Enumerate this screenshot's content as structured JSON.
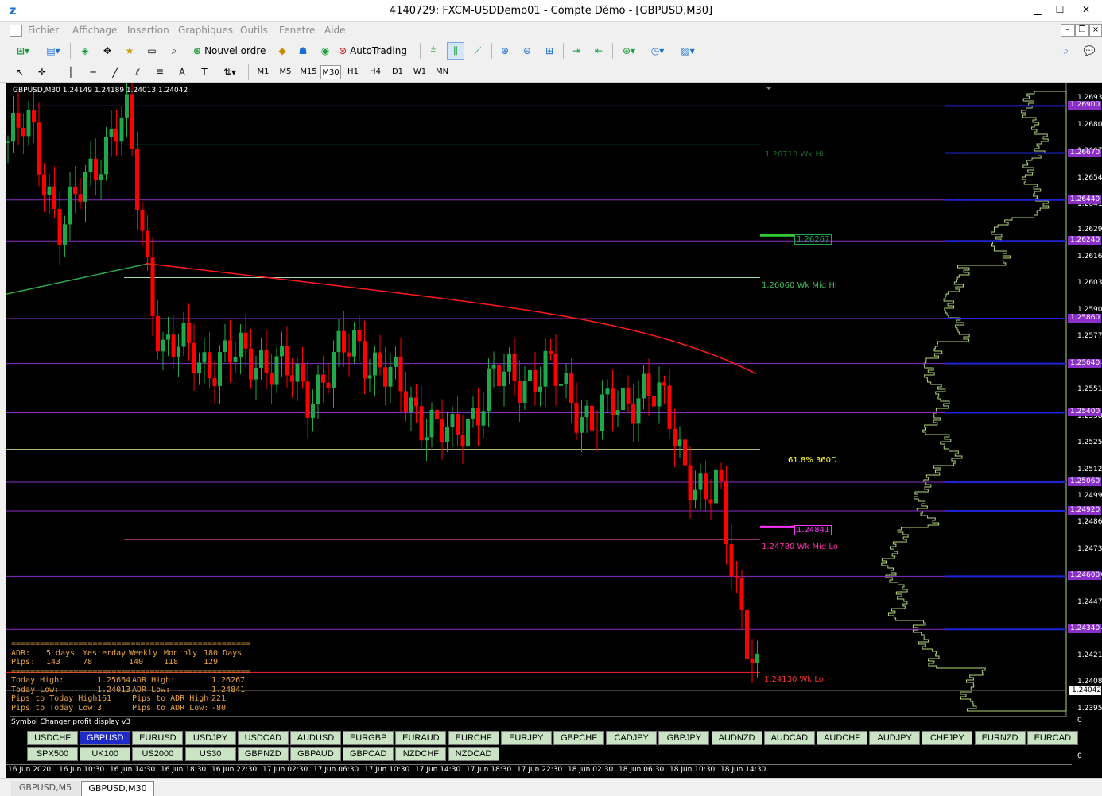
{
  "window": {
    "title": "4140729: FXCM-USDDemo01 - Compte Démo - [GBPUSD,M30]",
    "min": "▁",
    "max": "☐",
    "close": "✕"
  },
  "menu": [
    "Fichier",
    "Affichage",
    "Insertion",
    "Graphiques",
    "Outils",
    "Fenetre",
    "Aide"
  ],
  "mdi": {
    "min": "–",
    "restore": "❐",
    "close": "×"
  },
  "toolbar": {
    "new_order": "Nouvel ordre",
    "autotrading": "AutoTrading"
  },
  "timeframes": [
    "M1",
    "M5",
    "M15",
    "M30",
    "H1",
    "H4",
    "D1",
    "W1",
    "MN"
  ],
  "active_timeframe": "M30",
  "chart": {
    "label": "GBPUSD,M30  1.24149 1.24189 1.24013 1.24042",
    "price_axis": [
      "1.26935",
      "1.26805",
      "1.26675",
      "1.26545",
      "1.26415",
      "1.26290",
      "1.26160",
      "1.26030",
      "1.25900",
      "1.25770",
      "1.25640",
      "1.25510",
      "1.25380",
      "1.25250",
      "1.25120",
      "1.24990",
      "1.24860",
      "1.24730",
      "1.24600",
      "1.24470",
      "1.24340",
      "1.24210",
      "1.24080",
      "1.23950"
    ],
    "h_levels": [
      "1.26900",
      "1.26670",
      "1.26440",
      "1.26240",
      "1.25860",
      "1.25640",
      "1.25400",
      "1.25060",
      "1.24920",
      "1.24600",
      "1.24340"
    ],
    "current_price": "1.24042",
    "annotations": {
      "wk_hi": "1.26710  Wk Hi",
      "adr_high": "1.26267",
      "wk_mid_hi": "1.26060  Wk Mid Hi",
      "fib": "61.8% 360D",
      "adr_low": "1.24841",
      "wk_mid_lo": "1.24780  Wk Mid Lo",
      "wk_lo": "1.24130  Wk Lo"
    },
    "colors": {
      "bull": "#1fa84a",
      "bear": "#ff0000",
      "level": "#8b2fc9",
      "ma": "#ff1a1a",
      "vol": "#b3d77a"
    }
  },
  "chart_data": {
    "type": "candlestick",
    "symbol": "GBPUSD",
    "timeframe": "M30",
    "ohlc_last": {
      "open": 1.24149,
      "high": 1.24189,
      "low": 1.24013,
      "close": 1.24042
    },
    "ylim": [
      1.2391,
      1.2701
    ]
  },
  "stats": {
    "sep": "==================================================",
    "adr_label": "ADR:",
    "h5": "5 days",
    "hy": "Yesterday",
    "hw": "Weekly",
    "hm": "Monthly",
    "h180": "180 Days",
    "pips_label": "Pips:",
    "p5": "143",
    "py": "78",
    "pw": "140",
    "pm": "118",
    "p180": "129",
    "today_high_label": "Today High:",
    "today_high": "1.25664",
    "adr_high_label": "ADR High:",
    "adr_high": "1.26267",
    "today_low_label": "Today Low:",
    "today_low": "1.24013",
    "adr_low_label": "ADR Low:",
    "adr_low": "1.24841",
    "ptth_label": "Pips to Today High:",
    "ptth": "161",
    "ptah_label": "Pips to ADR High:",
    "ptah": "221",
    "pttl_label": "Pips to Today Low:",
    "pttl": "3",
    "ptal_label": "Pips to ADR Low:",
    "ptal": "-80"
  },
  "symbol_panel": {
    "caption": "Symbol Changer profit display v3",
    "row1": [
      "USDCHF",
      "GBPUSD",
      "EURUSD",
      "USDJPY",
      "USDCAD",
      "AUDUSD",
      "EURGBP",
      "EURAUD",
      "EURCHF",
      "EURJPY",
      "GBPCHF",
      "CADJPY",
      "GBPJPY",
      "AUDNZD",
      "AUDCAD",
      "AUDCHF",
      "AUDJPY",
      "CHFJPY",
      "EURNZD",
      "EURCAD"
    ],
    "row2": [
      "SPX500",
      "UK100",
      "US2000",
      "US30",
      "GBPNZD",
      "GBPAUD",
      "GBPCAD",
      "NZDCHF",
      "NZDCAD"
    ],
    "active": "GBPUSD"
  },
  "time_axis": [
    "16 Jun 2020",
    "16 Jun 10:30",
    "16 Jun 14:30",
    "16 Jun 18:30",
    "16 Jun 22:30",
    "17 Jun 02:30",
    "17 Jun 06:30",
    "17 Jun 10:30",
    "17 Jun 14:30",
    "17 Jun 18:30",
    "17 Jun 22:30",
    "18 Jun 02:30",
    "18 Jun 06:30",
    "18 Jun 10:30",
    "18 Jun 14:30"
  ],
  "tabs": [
    "GBPUSD,M5",
    "GBPUSD,M30"
  ],
  "active_tab": "GBPUSD,M30"
}
